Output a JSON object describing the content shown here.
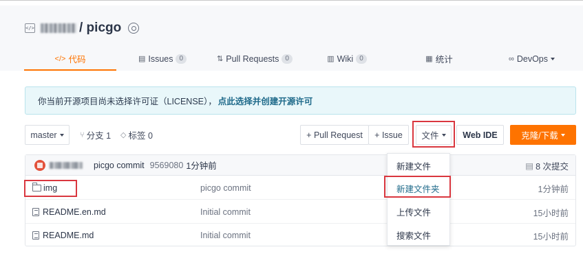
{
  "repo": {
    "name": "/ picgo",
    "code_icon": "</>"
  },
  "tabs": [
    {
      "icon": "</>",
      "label": "代码",
      "count": ""
    },
    {
      "icon": "▤",
      "label": "Issues",
      "count": "0"
    },
    {
      "icon": "⇅",
      "label": "Pull Requests",
      "count": "0"
    },
    {
      "icon": "▥",
      "label": "Wiki",
      "count": "0"
    },
    {
      "icon": "▦",
      "label": "统计",
      "count": ""
    },
    {
      "icon": "∞",
      "label": "DevOps",
      "count": ""
    }
  ],
  "notice": {
    "text": "你当前开源项目尚未选择许可证（LICENSE），",
    "link": "点此选择并创建开源许可"
  },
  "toolbar": {
    "branch": "master",
    "branch_count_label": "分支 1",
    "tag_count_label": "标签 0",
    "pull_request": "+ Pull Request",
    "issue": "+ Issue",
    "file_menu": "文件",
    "web_ide": "Web IDE",
    "clone_download": "克隆/下载"
  },
  "commit": {
    "message": "picgo commit",
    "hash": "9569080",
    "time": "1分钟前",
    "count_label": "8 次提交"
  },
  "files": [
    {
      "name": "img",
      "type": "folder",
      "message": "picgo commit",
      "time": "1分钟前"
    },
    {
      "name": "README.en.md",
      "type": "file",
      "message": "Initial commit",
      "time": "15小时前"
    },
    {
      "name": "README.md",
      "type": "file",
      "message": "Initial commit",
      "time": "15小时前"
    }
  ],
  "file_menu_items": [
    "新建文件",
    "新建文件夹",
    "上传文件",
    "搜索文件"
  ],
  "colors": {
    "accent": "#fe7300",
    "highlight_box": "#d9363e",
    "notice_bg": "#e9f7fa",
    "link": "#1f6a8a"
  }
}
